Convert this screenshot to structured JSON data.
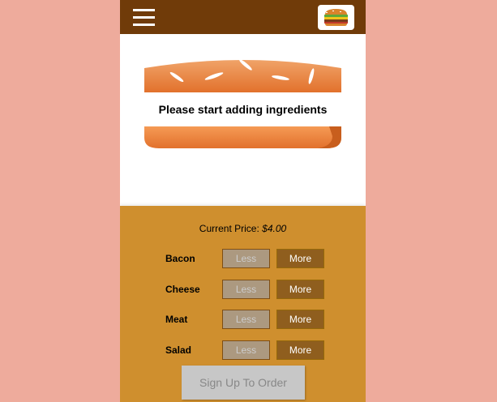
{
  "toolbar": {
    "menu_icon": "hamburger-menu-icon",
    "logo_icon": "burger-logo-icon"
  },
  "burger": {
    "message": "Please start adding ingredients"
  },
  "controls": {
    "price_label": "Current Price:",
    "price_value": "$4.00",
    "ingredients": [
      {
        "label": "Bacon",
        "less": "Less",
        "more": "More"
      },
      {
        "label": "Cheese",
        "less": "Less",
        "more": "More"
      },
      {
        "label": "Meat",
        "less": "Less",
        "more": "More"
      },
      {
        "label": "Salad",
        "less": "Less",
        "more": "More"
      }
    ],
    "order_button": "Sign Up To Order"
  },
  "colors": {
    "background": "#eeab9c",
    "toolbar": "#703b09",
    "controls_bg": "#cf8f2e",
    "bread": "#e27b36",
    "less_button": "#ac9980",
    "more_button": "#8f5e1e"
  }
}
